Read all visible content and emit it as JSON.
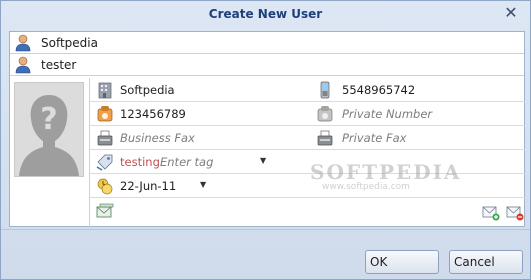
{
  "dialog": {
    "title": "Create New User",
    "close_glyph": "✕"
  },
  "user": {
    "first_name": "Softpedia",
    "last_name": "tester"
  },
  "fields": {
    "company": "Softpedia",
    "mobile": "5548965742",
    "phone": "123456789",
    "private_number_placeholder": "Private Number",
    "business_fax_placeholder": "Business Fax",
    "private_fax_placeholder": "Private Fax",
    "tag_value": "testing",
    "tag_placeholder": "Enter tag",
    "date": "22-Jun-11"
  },
  "watermark": {
    "text": "SOFTPEDIA",
    "url": "www.softpedia.com"
  },
  "buttons": {
    "ok": "OK",
    "cancel": "Cancel"
  },
  "icons": {
    "user": "user-icon",
    "building": "building-icon",
    "mobile": "mobile-phone-icon",
    "phone": "phone-icon",
    "fax": "fax-icon",
    "tag": "tag-icon",
    "calendar": "calendar-icon",
    "email": "envelope-icon"
  }
}
